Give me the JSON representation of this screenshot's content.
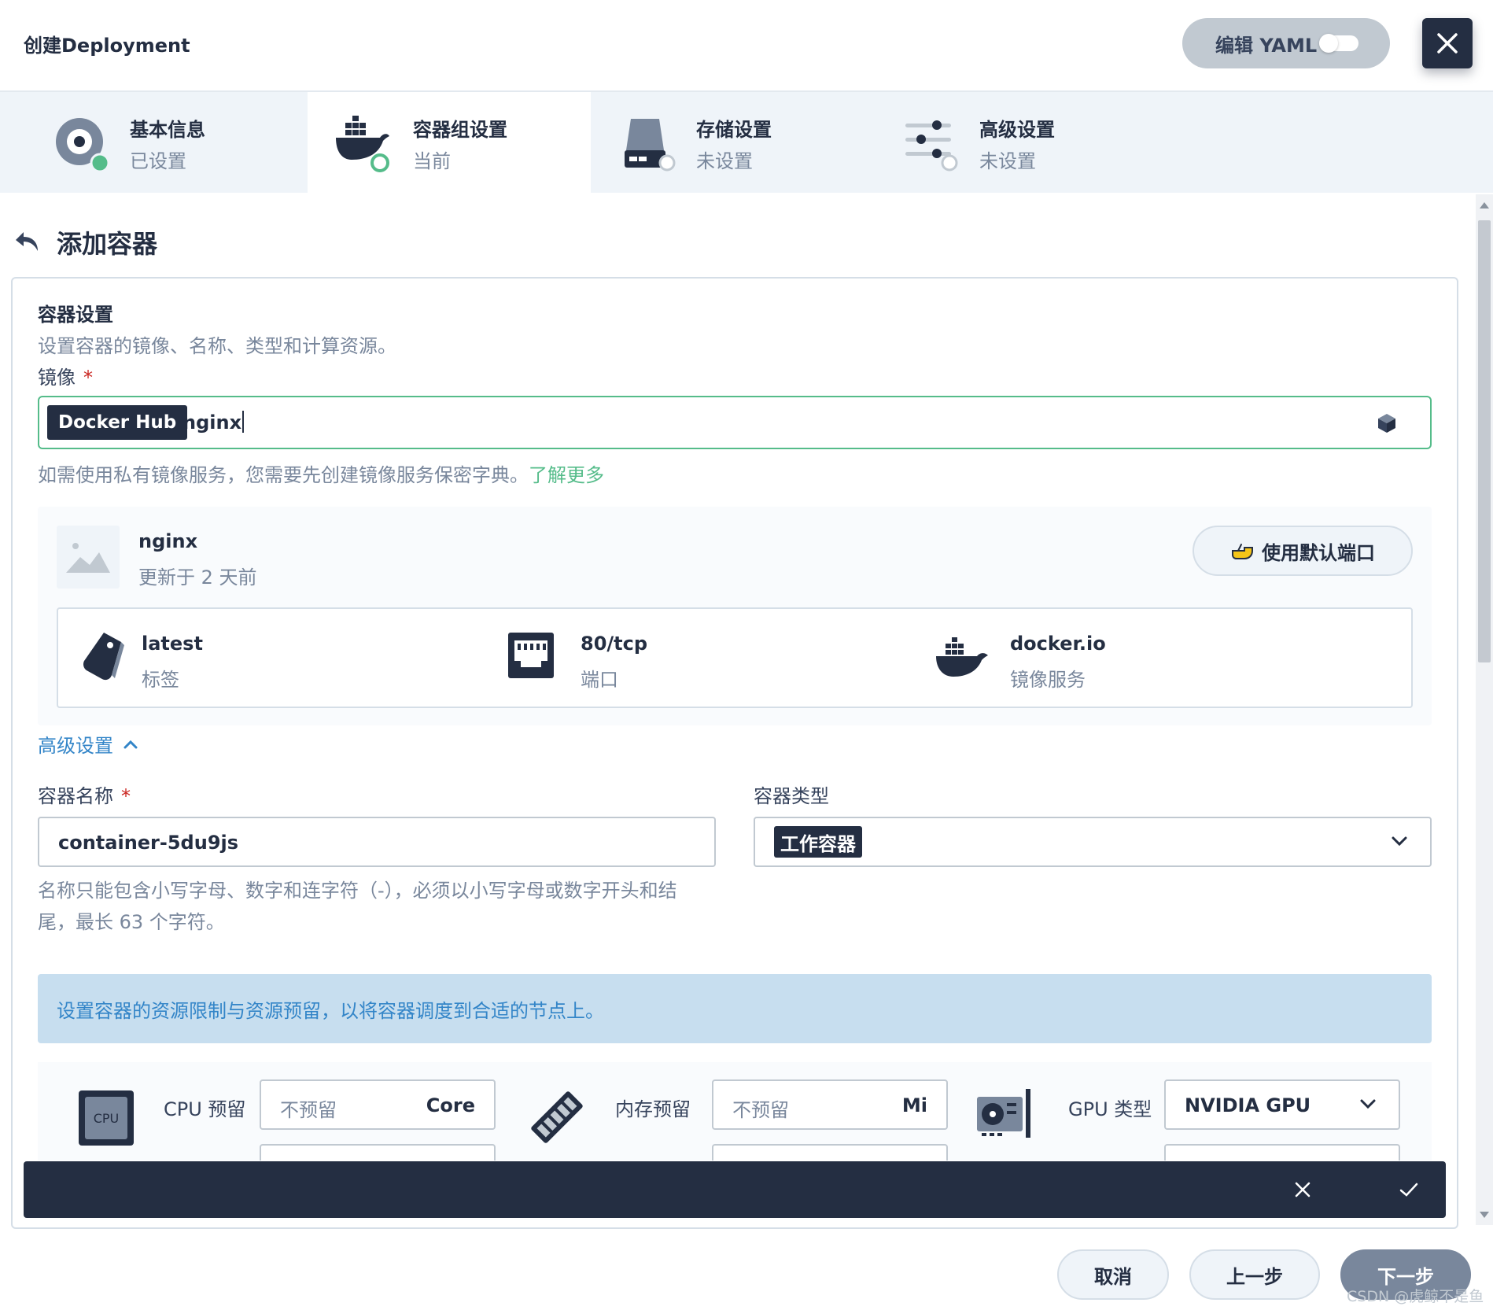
{
  "header": {
    "title": "创建Deployment",
    "yaml_label": "编辑 YAML"
  },
  "steps": [
    {
      "title": "基本信息",
      "status": "已设置",
      "icon": "settings-circle-icon"
    },
    {
      "title": "容器组设置",
      "status": "当前",
      "icon": "docker-icon"
    },
    {
      "title": "存储设置",
      "status": "未设置",
      "icon": "storage-icon"
    },
    {
      "title": "高级设置",
      "status": "未设置",
      "icon": "sliders-icon"
    }
  ],
  "page": {
    "back_title": "添加容器"
  },
  "container_settings": {
    "title": "容器设置",
    "description": "设置容器的镜像、名称、类型和计算资源。",
    "image_label": "镜像",
    "required_mark": "*",
    "registry": "Docker Hub",
    "image_value": "nginx",
    "hint": "如需使用私有镜像服务，您需要先创建镜像服务保密字典。",
    "learn_more": "了解更多"
  },
  "image_card": {
    "name": "nginx",
    "updated": "更新于 2 天前",
    "default_port_button": "使用默认端口",
    "tag_value": "latest",
    "tag_key": "标签",
    "port_value": "80/tcp",
    "port_key": "端口",
    "registry_value": "docker.io",
    "registry_key": "镜像服务"
  },
  "advanced": {
    "toggle_label": "高级设置",
    "container_name_label": "容器名称",
    "container_name_value": "container-5du9js",
    "container_type_label": "容器类型",
    "container_type_value": "工作容器",
    "name_rule": "名称只能包含小写字母、数字和连字符（-），必须以小写字母或数字开头和结尾，最长 63 个字符。"
  },
  "resources": {
    "banner": "设置容器的资源限制与资源预留，以将容器调度到合适的节点上。",
    "cpu_label": "CPU 预留",
    "cpu_placeholder": "不预留",
    "cpu_unit": "Core",
    "cpu_chip_text": "CPU",
    "mem_label": "内存预留",
    "mem_placeholder": "不预留",
    "mem_unit": "Mi",
    "gpu_label": "GPU 类型",
    "gpu_value": "NVIDIA GPU"
  },
  "footer": {
    "cancel": "取消",
    "prev": "上一步",
    "next": "下一步",
    "watermark": "CSDN @虎鲸不是鱼"
  },
  "colors": {
    "primary_dark": "#242e42",
    "success_green": "#55bc8a",
    "link_blue": "#3385c8",
    "required_red": "#ca2621"
  }
}
